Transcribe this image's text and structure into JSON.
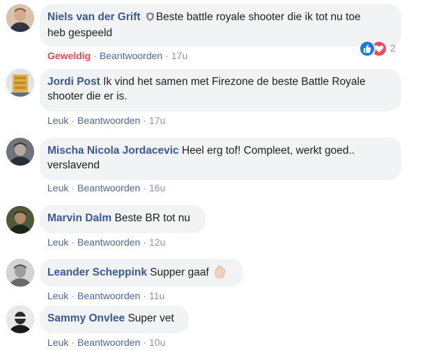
{
  "comments": [
    {
      "author": "Niels van der Grift",
      "text_line1": "Beste battle royale shooter die ik tot nu toe",
      "text_line2": "heb gespeeld",
      "reaction_label": "Geweldig",
      "reply_label": "Beantwoorden",
      "time": "17u",
      "reaction_count": "2"
    },
    {
      "author": "Jordi Post",
      "text_line1": "Ik vind het samen met Firezone de beste Battle Royale",
      "text_line2": "shooter die er is.",
      "reaction_label": "Leuk",
      "reply_label": "Beantwoorden",
      "time": "17u"
    },
    {
      "author": "Mischa Nicola Jordacevic",
      "text_line1": "Heel erg tof! Compleet, werkt goed..",
      "text_line2": "verslavend",
      "reaction_label": "Leuk",
      "reply_label": "Beantwoorden",
      "time": "16u"
    },
    {
      "author": "Marvin Dalm",
      "text_line1": "Beste BR tot nu",
      "reaction_label": "Leuk",
      "reply_label": "Beantwoorden",
      "time": "12u"
    },
    {
      "author": "Leander Scheppink",
      "text_line1": "Supper gaaf",
      "reaction_label": "Leuk",
      "reply_label": "Beantwoorden",
      "time": "11u"
    },
    {
      "author": "Sammy Onvlee",
      "text_line1": "Super vet",
      "reaction_label": "Leuk",
      "reply_label": "Beantwoorden",
      "time": "10u"
    }
  ],
  "separator": "·",
  "icons": {
    "verified": "shield-icon",
    "like": "like-reaction-icon",
    "love": "love-reaction-icon",
    "hand": "ok-hand-emoji-icon"
  },
  "colors": {
    "author": "#385898",
    "link": "#4b67a1",
    "love": "#e04e4e",
    "bubble": "#f2f3f5",
    "meta": "#90949c"
  }
}
